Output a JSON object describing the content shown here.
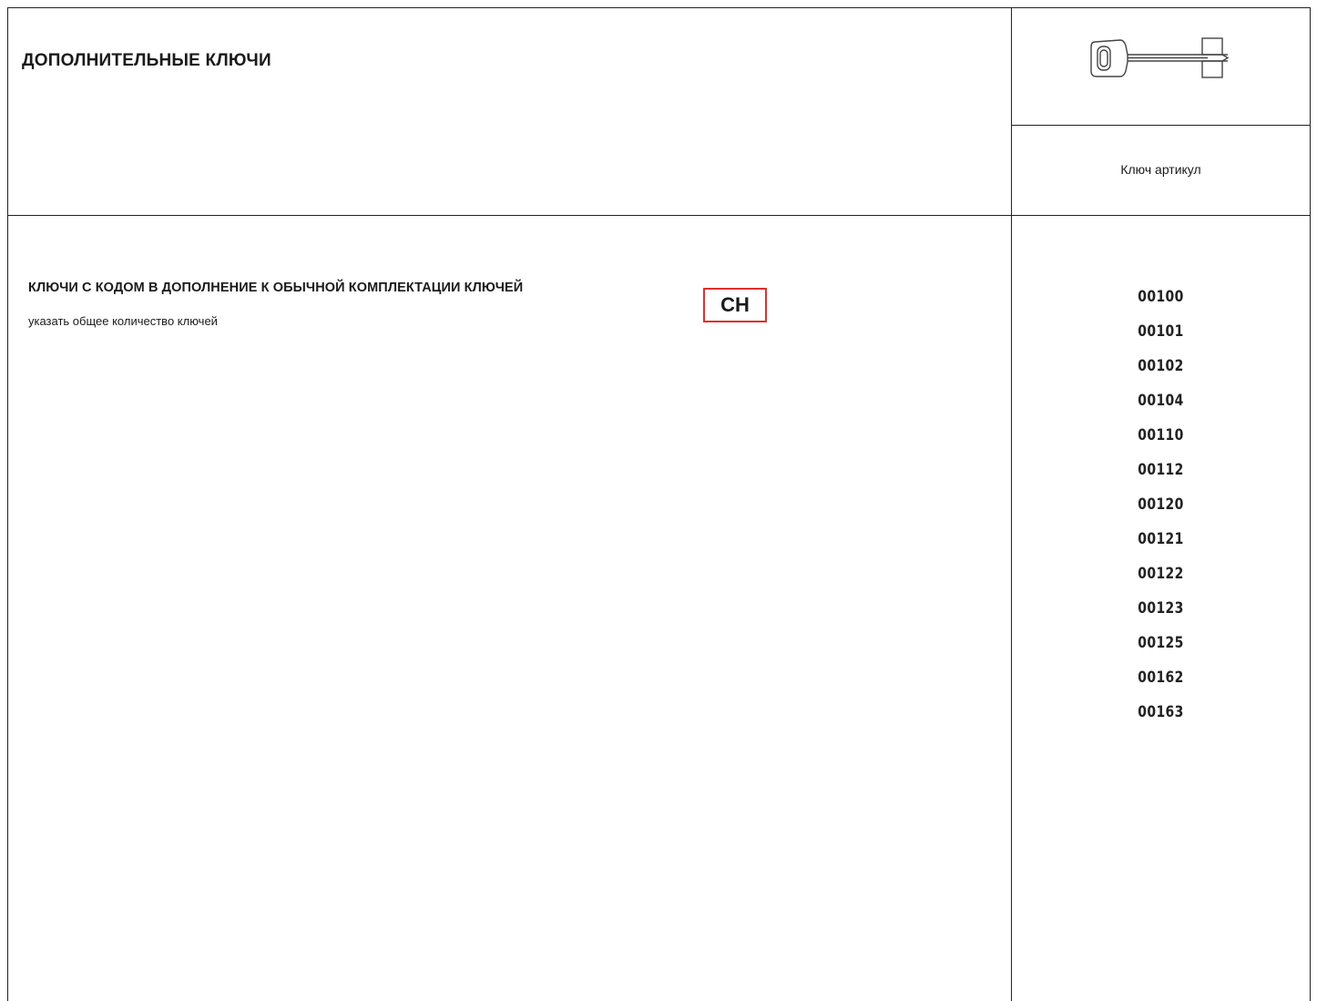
{
  "header": {
    "title": "ДОПОЛНИТЕЛЬНЫЕ КЛЮЧИ",
    "key_icon": "key-icon",
    "article_label": "Ключ артикул"
  },
  "section": {
    "title": "КЛЮЧИ С КОДОМ В ДОПОЛНЕНИЕ К ОБЫЧНОЙ КОМПЛЕКТАЦИИ КЛЮЧЕЙ",
    "subtitle": "указать общее количество ключей",
    "badge": "CH",
    "badge_color": "#e0302b"
  },
  "codes": [
    "00100",
    "00101",
    "00102",
    "00104",
    "00110",
    "00112",
    "00120",
    "00121",
    "00122",
    "00123",
    "00125",
    "00162",
    "00163"
  ]
}
